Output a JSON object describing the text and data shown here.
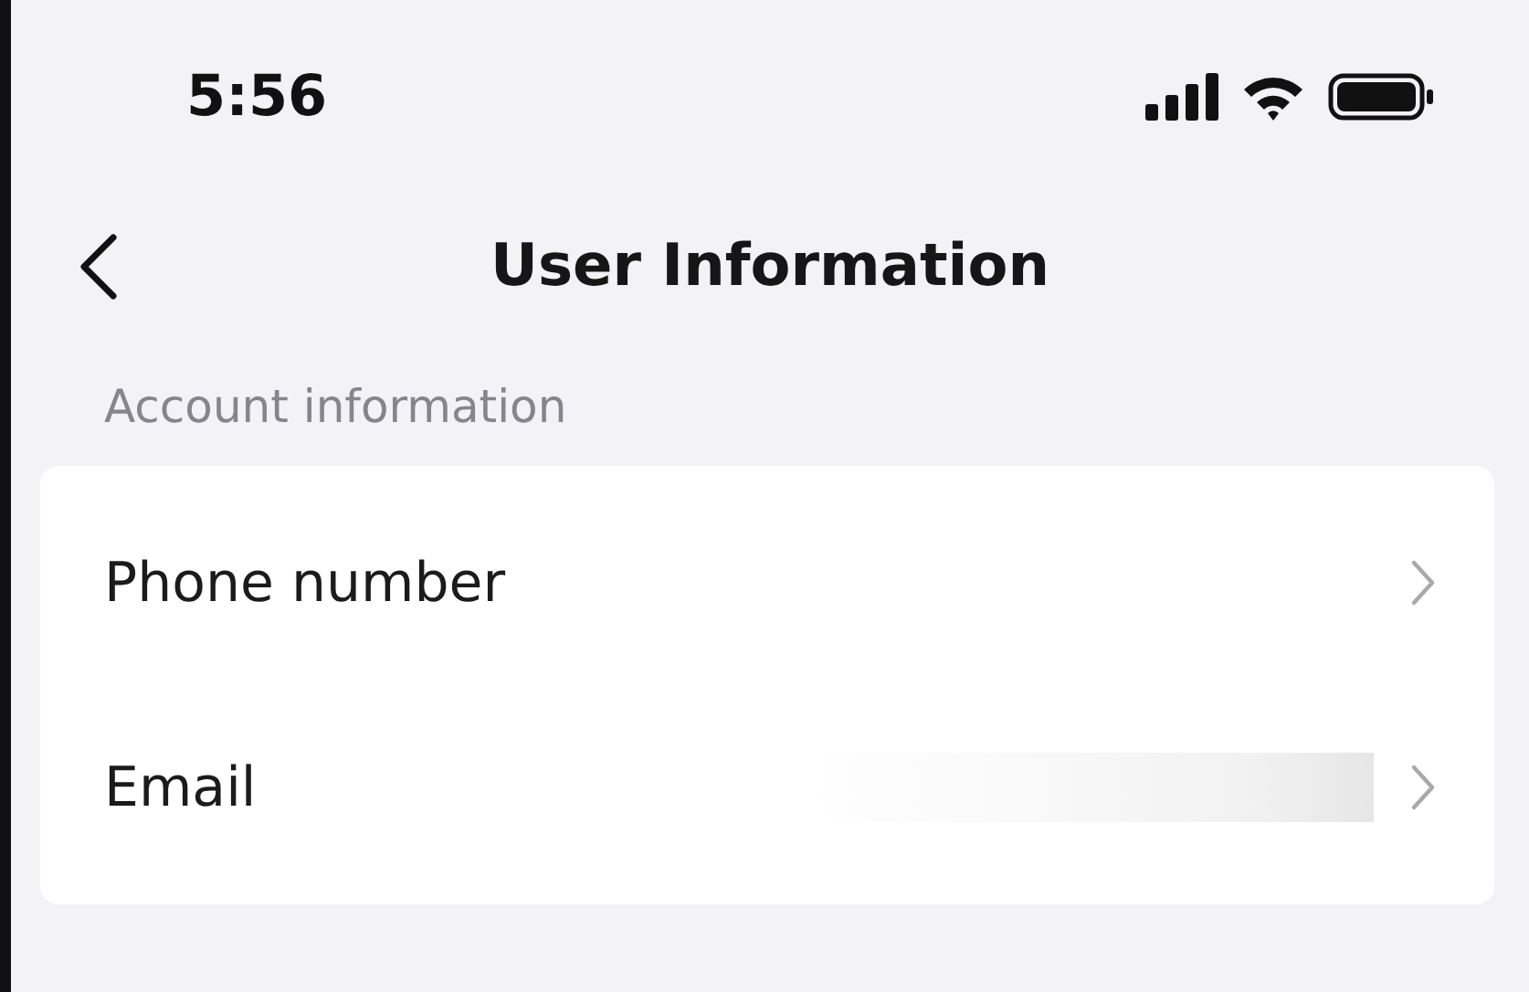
{
  "status_bar": {
    "time": "5:56"
  },
  "header": {
    "title": "User Information"
  },
  "section": {
    "label": "Account information"
  },
  "rows": [
    {
      "label": "Phone number",
      "redacted": false
    },
    {
      "label": "Email",
      "redacted": true
    }
  ]
}
